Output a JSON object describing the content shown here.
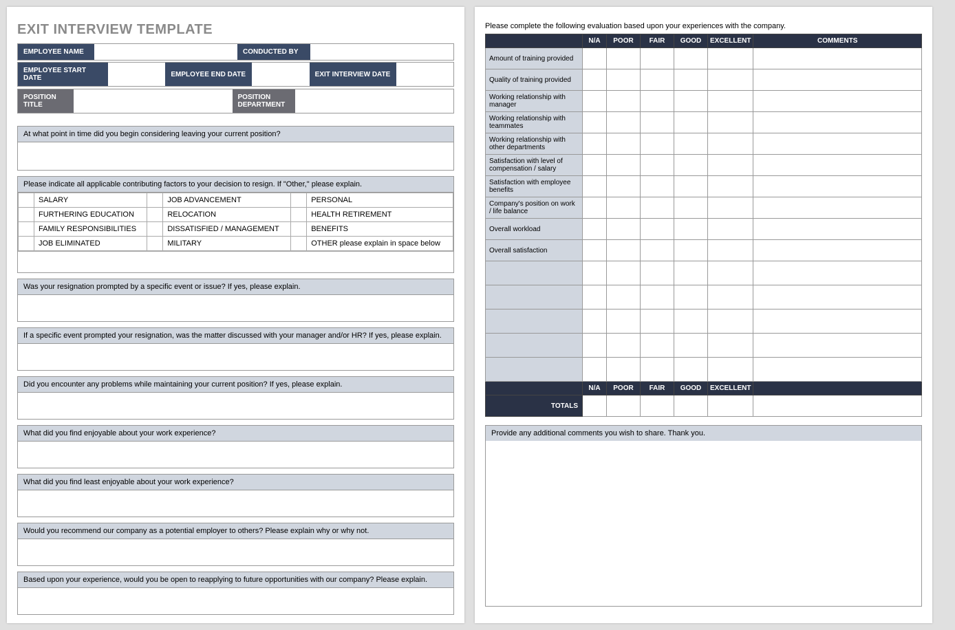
{
  "title": "EXIT INTERVIEW TEMPLATE",
  "header": {
    "employee_name": "EMPLOYEE NAME",
    "conducted_by": "CONDUCTED BY",
    "employee_start_date": "EMPLOYEE START DATE",
    "employee_end_date": "EMPLOYEE END DATE",
    "exit_interview_date": "EXIT INTERVIEW DATE",
    "position_title": "POSITION TITLE",
    "position_department": "POSITION DEPARTMENT"
  },
  "questions": {
    "q1": "At what point in time did you begin considering leaving your current position?",
    "q2": "Please indicate all applicable contributing factors to your decision to resign. If \"Other,\" please explain.",
    "q3": "Was your resignation prompted by a specific event or issue? If yes, please explain.",
    "q4": "If a specific event prompted your resignation, was the matter discussed with your manager and/or HR? If yes, please explain.",
    "q5": "Did you encounter any problems while maintaining your current position?  If yes, please explain.",
    "q6": "What did you find enjoyable about your work experience?",
    "q7": "What did you find least enjoyable about your work experience?",
    "q8": "Would you recommend our company as a potential employer to others? Please explain why or why not.",
    "q9": "Based upon your experience, would you be open to reapplying to future opportunities with our company?  Please explain."
  },
  "factors": [
    [
      "SALARY",
      "JOB ADVANCEMENT",
      "PERSONAL"
    ],
    [
      "FURTHERING EDUCATION",
      "RELOCATION",
      "HEALTH RETIREMENT"
    ],
    [
      "FAMILY RESPONSIBILITIES",
      "DISSATISFIED / MANAGEMENT",
      "BENEFITS"
    ],
    [
      "JOB ELIMINATED",
      "MILITARY",
      "OTHER please explain in space below"
    ]
  ],
  "page2": {
    "intro": "Please complete the following evaluation based upon your experiences with the company.",
    "cols": {
      "na": "N/A",
      "poor": "POOR",
      "fair": "FAIR",
      "good": "GOOD",
      "excellent": "EXCELLENT",
      "comments": "COMMENTS"
    },
    "rows": [
      "Amount of training provided",
      "Quality of training provided",
      "Working relationship with manager",
      "Working relationship with teammates",
      "Working relationship with other departments",
      "Satisfaction with level of compensation / salary",
      "Satisfaction with employee benefits",
      "Company's position on work / life balance",
      "Overall workload",
      "Overall satisfaction"
    ],
    "totals": "TOTALS",
    "additional": "Provide any additional comments you wish to share.  Thank you."
  }
}
